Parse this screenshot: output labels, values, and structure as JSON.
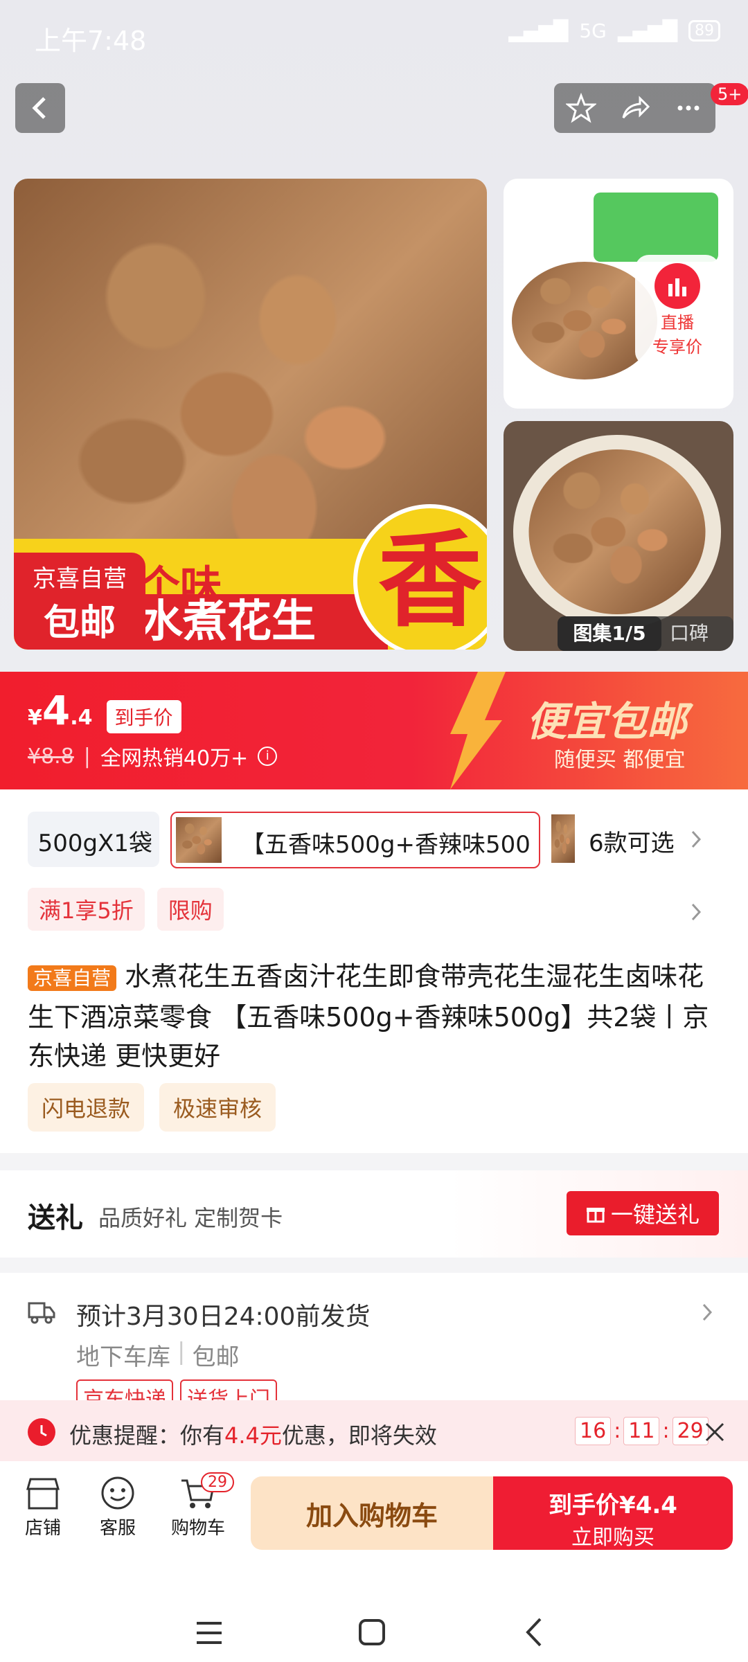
{
  "status_bar": {
    "time": "上午7:48",
    "battery": "89",
    "network": "5G"
  },
  "nav": {
    "badge": "5+"
  },
  "gallery": {
    "main_overlay_text1": "就是这个味",
    "main_overlay_text2": "水煮花生",
    "main_big_char": "香",
    "badge_line1": "京喜自营",
    "badge_line2": "包邮",
    "live_line1": "直播",
    "live_line2": "专享价",
    "album_label": "图集1/5",
    "reviews_label": "口碑"
  },
  "price": {
    "currency": "¥",
    "main": "4",
    "decimal": ".4",
    "final_tag": "到手价",
    "original": "¥8.8",
    "sales": "全网热销40万+",
    "promo_title": "便宜包邮",
    "promo_sub": "随便买 都便宜"
  },
  "variants": {
    "items": [
      "500gX1袋",
      "【五香味500g+香辣味500"
    ],
    "more": "6款可选"
  },
  "promo_tags": [
    "满1享5折",
    "限购"
  ],
  "product": {
    "store_tag": "京喜自营",
    "title": "水煮花生五香卤汁花生即食带壳花生湿花生卤味花生下酒凉菜零食 【五香味500g+香辣味500g】共2袋丨京东快递 更快更好",
    "service_tags": [
      "闪电退款",
      "极速审核"
    ]
  },
  "gift": {
    "title": "送礼",
    "subtitle": "品质好礼 定制贺卡",
    "button": "一键送礼"
  },
  "shipping": {
    "estimate": "预计3月30日24:00前发货",
    "location": "地下车库",
    "free": "包邮",
    "tags": [
      "京东快递",
      "送货上门"
    ]
  },
  "reminder": {
    "prefix": "优惠提醒：你有",
    "amount": "4.4元",
    "suffix": "优惠，即将失效",
    "timer": [
      "16",
      "11",
      "29"
    ]
  },
  "tabbar": {
    "shop": "店铺",
    "service": "客服",
    "cart": "购物车",
    "cart_count": "29",
    "add_cart": "加入购物车",
    "buy_price": "到手价¥4.4",
    "buy_now": "立即购买"
  },
  "colors": {
    "brand_red": "#f11e2d",
    "promo_orange": "#f76b3e"
  }
}
